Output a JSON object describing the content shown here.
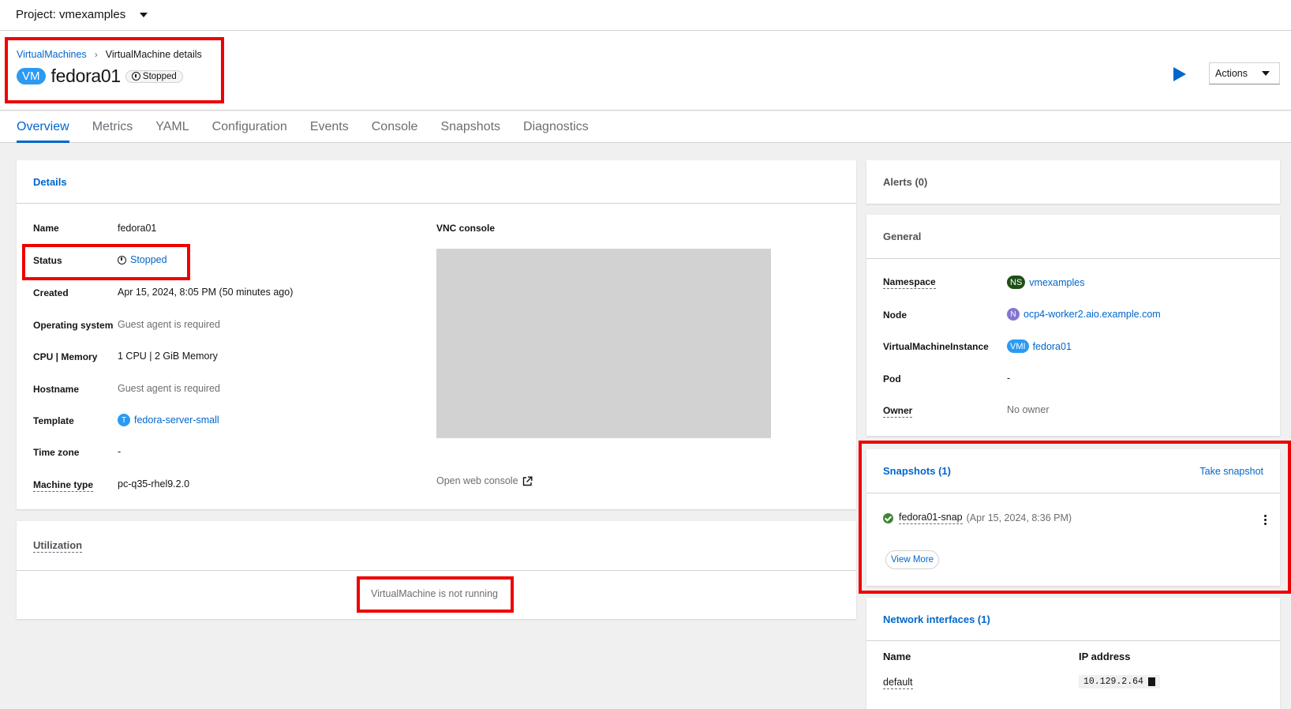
{
  "project": {
    "label": "Project: vmexamples"
  },
  "breadcrumb": {
    "parent": "VirtualMachines",
    "separator": "›",
    "current": "VirtualMachine details"
  },
  "vm": {
    "badge": "VM",
    "name": "fedora01",
    "status": "Stopped"
  },
  "toolbar": {
    "actions_label": "Actions"
  },
  "tabs": [
    {
      "label": "Overview"
    },
    {
      "label": "Metrics"
    },
    {
      "label": "YAML"
    },
    {
      "label": "Configuration"
    },
    {
      "label": "Events"
    },
    {
      "label": "Console"
    },
    {
      "label": "Snapshots"
    },
    {
      "label": "Diagnostics"
    }
  ],
  "details": {
    "title": "Details",
    "rows": {
      "name": {
        "label": "Name",
        "value": "fedora01"
      },
      "status": {
        "label": "Status",
        "value": "Stopped"
      },
      "created": {
        "label": "Created",
        "value": "Apr 15, 2024, 8:05 PM (50 minutes ago)"
      },
      "os": {
        "label": "Operating system",
        "value": "Guest agent is required"
      },
      "cpu": {
        "label": "CPU | Memory",
        "value": "1 CPU | 2 GiB Memory"
      },
      "hostname": {
        "label": "Hostname",
        "value": "Guest agent is required"
      },
      "template": {
        "label": "Template",
        "badge": "T",
        "value": "fedora-server-small"
      },
      "timezone": {
        "label": "Time zone",
        "value": "-"
      },
      "machine_type": {
        "label": "Machine type",
        "value": "pc-q35-rhel9.2.0"
      }
    },
    "vnc_label": "VNC console",
    "open_console": "Open web console"
  },
  "utilization": {
    "title": "Utilization",
    "message": "VirtualMachine is not running"
  },
  "alerts": {
    "title": "Alerts (0)"
  },
  "general": {
    "title": "General",
    "namespace": {
      "label": "Namespace",
      "badge": "NS",
      "value": "vmexamples"
    },
    "node": {
      "label": "Node",
      "badge": "N",
      "value": "ocp4-worker2.aio.example.com"
    },
    "vmi": {
      "label": "VirtualMachineInstance",
      "badge": "VMI",
      "value": "fedora01"
    },
    "pod": {
      "label": "Pod",
      "value": "-"
    },
    "owner": {
      "label": "Owner",
      "value": "No owner"
    }
  },
  "snapshots": {
    "title": "Snapshots (1)",
    "take_label": "Take snapshot",
    "item_name": "fedora01-snap",
    "item_time": "(Apr 15, 2024, 8:36 PM)",
    "view_more": "View More"
  },
  "network": {
    "title": "Network interfaces (1)",
    "col_name": "Name",
    "col_ip": "IP address",
    "row_name": "default",
    "row_ip": "10.129.2.64"
  },
  "colors": {
    "accent": "#0066cc",
    "highlight": "#ee0000",
    "ns_badge": "#1e4f18",
    "node_badge": "#8476d1",
    "vm_badge": "#2b9af3"
  }
}
